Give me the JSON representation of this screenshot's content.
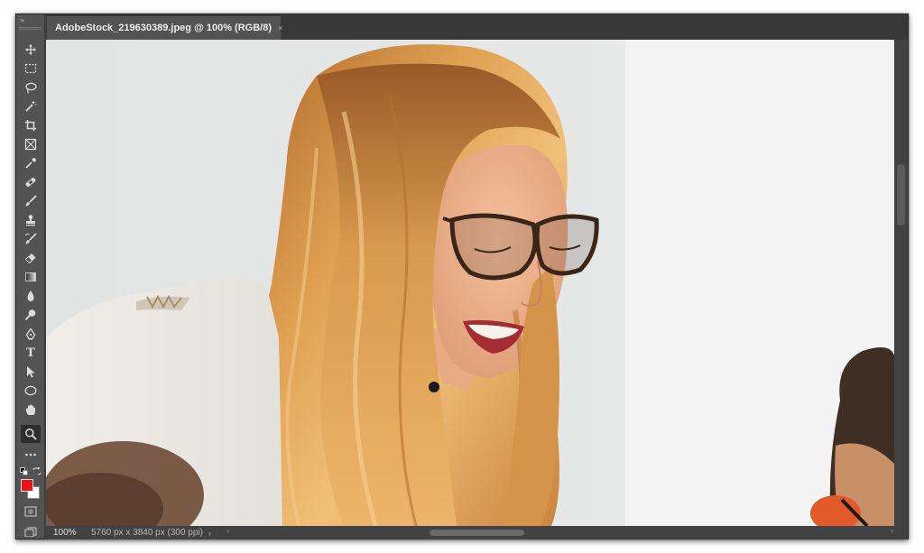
{
  "document_tab": {
    "title": "AdobeStock_219630389.jpeg @ 100% (RGB/8)",
    "close_glyph": "×"
  },
  "toolbar": {
    "collapse_glyph": "››",
    "tools": [
      {
        "name": "move-tool",
        "icon": "move-icon"
      },
      {
        "name": "rectangular-marquee-tool",
        "icon": "marquee-icon"
      },
      {
        "name": "lasso-tool",
        "icon": "lasso-icon"
      },
      {
        "name": "magic-wand-tool",
        "icon": "magic-wand-icon"
      },
      {
        "name": "crop-tool",
        "icon": "crop-icon"
      },
      {
        "name": "frame-tool",
        "icon": "frame-icon"
      },
      {
        "name": "eyedropper-tool",
        "icon": "eyedropper-icon"
      },
      {
        "name": "healing-brush-tool",
        "icon": "bandage-icon"
      },
      {
        "name": "brush-tool",
        "icon": "brush-icon"
      },
      {
        "name": "clone-stamp-tool",
        "icon": "stamp-icon"
      },
      {
        "name": "history-brush-tool",
        "icon": "history-brush-icon"
      },
      {
        "name": "eraser-tool",
        "icon": "eraser-icon"
      },
      {
        "name": "gradient-tool",
        "icon": "gradient-icon"
      },
      {
        "name": "blur-tool",
        "icon": "drop-icon"
      },
      {
        "name": "dodge-tool",
        "icon": "dodge-icon"
      },
      {
        "name": "pen-tool",
        "icon": "pen-icon"
      },
      {
        "name": "type-tool",
        "icon": "type-icon",
        "label": "T"
      },
      {
        "name": "path-selection-tool",
        "icon": "arrow-cursor-icon"
      },
      {
        "name": "ellipse-tool",
        "icon": "ellipse-icon"
      },
      {
        "name": "hand-tool",
        "icon": "hand-icon"
      },
      {
        "name": "zoom-tool",
        "icon": "magnifier-icon",
        "active": true
      },
      {
        "name": "edit-toolbar",
        "icon": "more-dots-icon"
      }
    ],
    "foreground_color": "#e8141b",
    "background_color": "#ffffff"
  },
  "status_bar": {
    "zoom": "100%",
    "doc_info": "5760 px x 3840 px (300 ppi)",
    "arrow": "›"
  },
  "colors": {
    "window_bg": "#424242",
    "panel_bg": "#535353",
    "tab_bar_bg": "#383838"
  }
}
